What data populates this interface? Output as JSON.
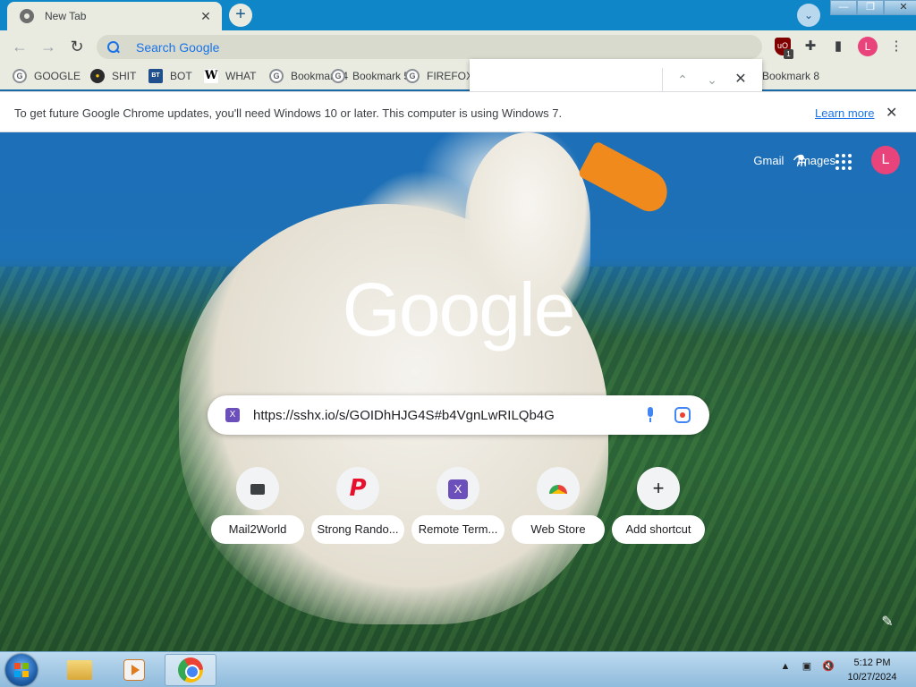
{
  "tab": {
    "title": "New Tab",
    "close": "✕"
  },
  "tabstrip": {
    "new_tab": "+",
    "tab_search": "⌄"
  },
  "window_controls": {
    "minimize": "—",
    "maximize": "❐",
    "close": "✕"
  },
  "toolbar": {
    "back": "←",
    "forward": "→",
    "reload": "↻",
    "omnibox_placeholder": "Search Google",
    "omnibox_value": "",
    "ext_ublock_label": "uO",
    "ext_badge": "1",
    "extensions_icon": "✚",
    "side_panel_icon": "▮",
    "profile_initial": "L",
    "menu_icon": "⋮"
  },
  "bookmarks": [
    {
      "label": "GOOGLE",
      "icon": "G"
    },
    {
      "label": "SHIT",
      "icon": ""
    },
    {
      "label": "BOT",
      "icon": "BT"
    },
    {
      "label": "WHAT",
      "icon": "W"
    },
    {
      "label": "Bookmark 4",
      "icon": "G"
    },
    {
      "label": "Bookmark 5",
      "icon": "G"
    },
    {
      "label": "FIREFOX",
      "icon": "G"
    },
    {
      "label": "Bookmark 8",
      "icon": ""
    }
  ],
  "findbar": {
    "value": "",
    "up": "⌃",
    "down": "⌄",
    "close": "✕"
  },
  "infobar": {
    "message": "To get future Google Chrome updates, you'll need Windows 10 or later. This computer is using Windows 7.",
    "link": "Learn more",
    "close": "✕"
  },
  "ntp": {
    "links": [
      "Gmail",
      "Images"
    ],
    "labs_icon": "⚗",
    "avatar_initial": "L",
    "logo": "Google",
    "realbox_value": "https://sshx.io/s/GOIDhHJG4S#b4VgnLwRILQb4G",
    "favicon_letter": "X",
    "shortcuts": [
      {
        "label": "Mail2World"
      },
      {
        "label": "Strong Rando...",
        "icon": "P"
      },
      {
        "label": "Remote Term...",
        "icon": "X"
      },
      {
        "label": "Web Store"
      },
      {
        "label": "Add shortcut",
        "icon": "+"
      }
    ],
    "customize_icon": "✎"
  },
  "taskbar": {
    "clock_time": "5:12 PM",
    "clock_date": "10/27/2024",
    "tray_arrow": "▲",
    "tray_network": "▣",
    "tray_volume": "🔇"
  },
  "colors": {
    "tabstrip": "#0f86c8",
    "toolbar": "#e9ebe1",
    "accent_blue": "#1a73e8",
    "avatar_pink": "#e8437a"
  }
}
